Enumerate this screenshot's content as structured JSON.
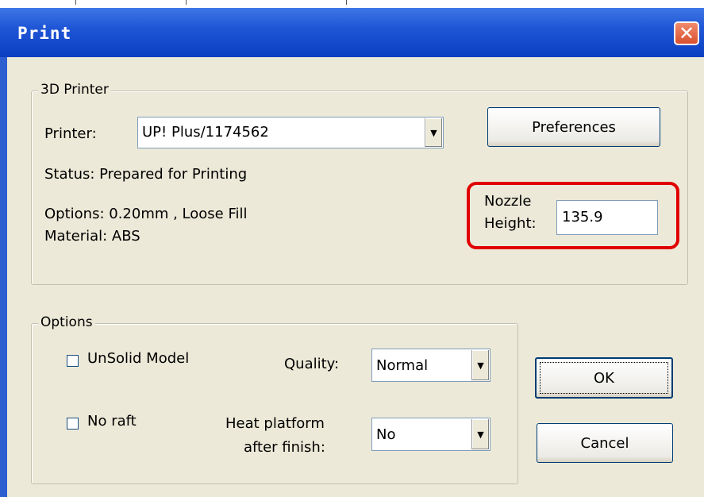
{
  "window": {
    "title": "Print",
    "close_glyph": "✕"
  },
  "printer_group": {
    "legend": "3D Printer",
    "printer_label": "Printer:",
    "printer_value": "UP! Plus/1174562",
    "preferences_label": "Preferences",
    "status": "Status: Prepared for Printing",
    "options": "Options: 0.20mm , Loose Fill",
    "material": "Material: ABS",
    "nozzle_label_line1": "Nozzle",
    "nozzle_label_line2": "Height:",
    "nozzle_value": "135.9"
  },
  "options_group": {
    "legend": "Options",
    "unsolid_label": "UnSolid Model",
    "unsolid_checked": false,
    "noraft_label": "No raft",
    "noraft_checked": false,
    "quality_label": "Quality:",
    "quality_value": "Normal",
    "heat_label_line1": "Heat platform",
    "heat_label_line2": "after finish:",
    "heat_value": "No"
  },
  "buttons": {
    "ok_label": "OK",
    "cancel_label": "Cancel"
  },
  "icons": {
    "dropdown": "dropdown-arrow-icon",
    "close": "close-icon"
  },
  "colors": {
    "highlight": "#e00000",
    "titlebar": "#0a3fc0",
    "client": "#ece9d8"
  }
}
